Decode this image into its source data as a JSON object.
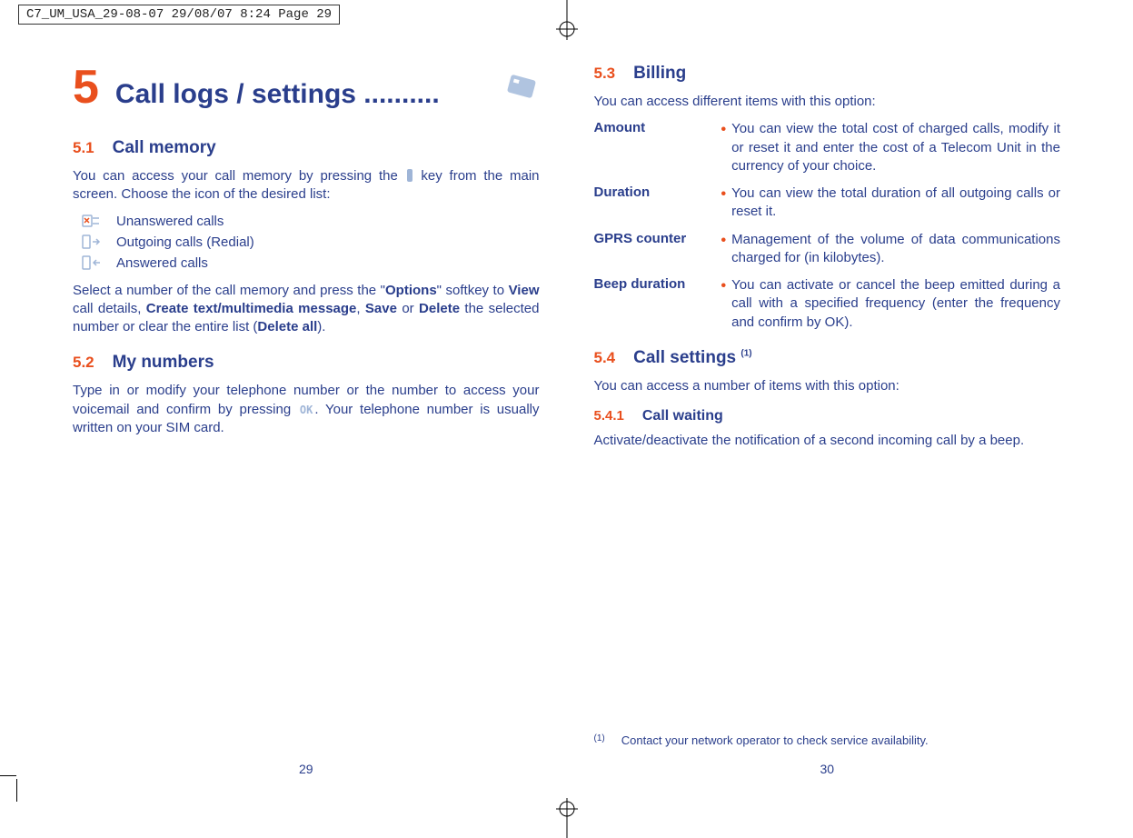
{
  "print_header": "C7_UM_USA_29-08-07  29/08/07  8:24  Page 29",
  "chapter": {
    "number": "5",
    "title": "Call logs / settings .........."
  },
  "left": {
    "s51_num": "5.1",
    "s51_title": "Call memory",
    "s51_p1a": "You can access your call memory by pressing the ",
    "s51_p1b": " key from the main screen. Choose the icon of the desired list:",
    "icons": {
      "unanswered": "Unanswered calls",
      "outgoing": "Outgoing calls (Redial)",
      "answered": "Answered calls"
    },
    "s51_p2_a": "Select a number of the call memory and press the \"",
    "s51_p2_b": "\" softkey to ",
    "s51_p2_c": " call details, ",
    "s51_p2_d": ", ",
    "s51_p2_e": " or ",
    "s51_p2_f": " the selected number or clear the entire list (",
    "s51_p2_g": ").",
    "bold": {
      "options": "Options",
      "view": "View",
      "create": "Create text/multimedia message",
      "save": "Save",
      "delete": "Delete",
      "delete_all": "Delete all"
    },
    "s52_num": "5.2",
    "s52_title": "My numbers",
    "s52_p_a": "Type in or modify your telephone number or the number to access your voicemail and confirm by pressing ",
    "s52_p_b": ". Your telephone number is usually written on your SIM card.",
    "page_num": "29"
  },
  "right": {
    "s53_num": "5.3",
    "s53_title": "Billing",
    "s53_intro": "You can access different items with this option:",
    "defs": {
      "amount_term": "Amount",
      "amount_def": "You can view the total cost of charged calls, modify it or reset it and enter the cost of a Telecom Unit in the currency of your choice.",
      "duration_term": "Duration",
      "duration_def": "You can view the total duration of all outgoing calls or reset it.",
      "gprs_term": "GPRS counter",
      "gprs_def": "Management of the volume of data communications charged for (in kilobytes).",
      "beep_term": "Beep duration",
      "beep_def_a": "You can activate or cancel the beep emitted during a call with a specified frequency (enter the frequency and confirm by ",
      "beep_def_b": ")."
    },
    "s54_num": "5.4",
    "s54_title": "Call settings ",
    "s54_note_mark": "(1)",
    "s54_intro": "You can access a number of items with this option:",
    "s541_num": "5.4.1",
    "s541_title": "Call waiting",
    "s541_p": "Activate/deactivate the notification of a second incoming call by a beep.",
    "footnote_mark": "(1)",
    "footnote_text": "Contact your network operator to check service availability.",
    "page_num": "30"
  }
}
